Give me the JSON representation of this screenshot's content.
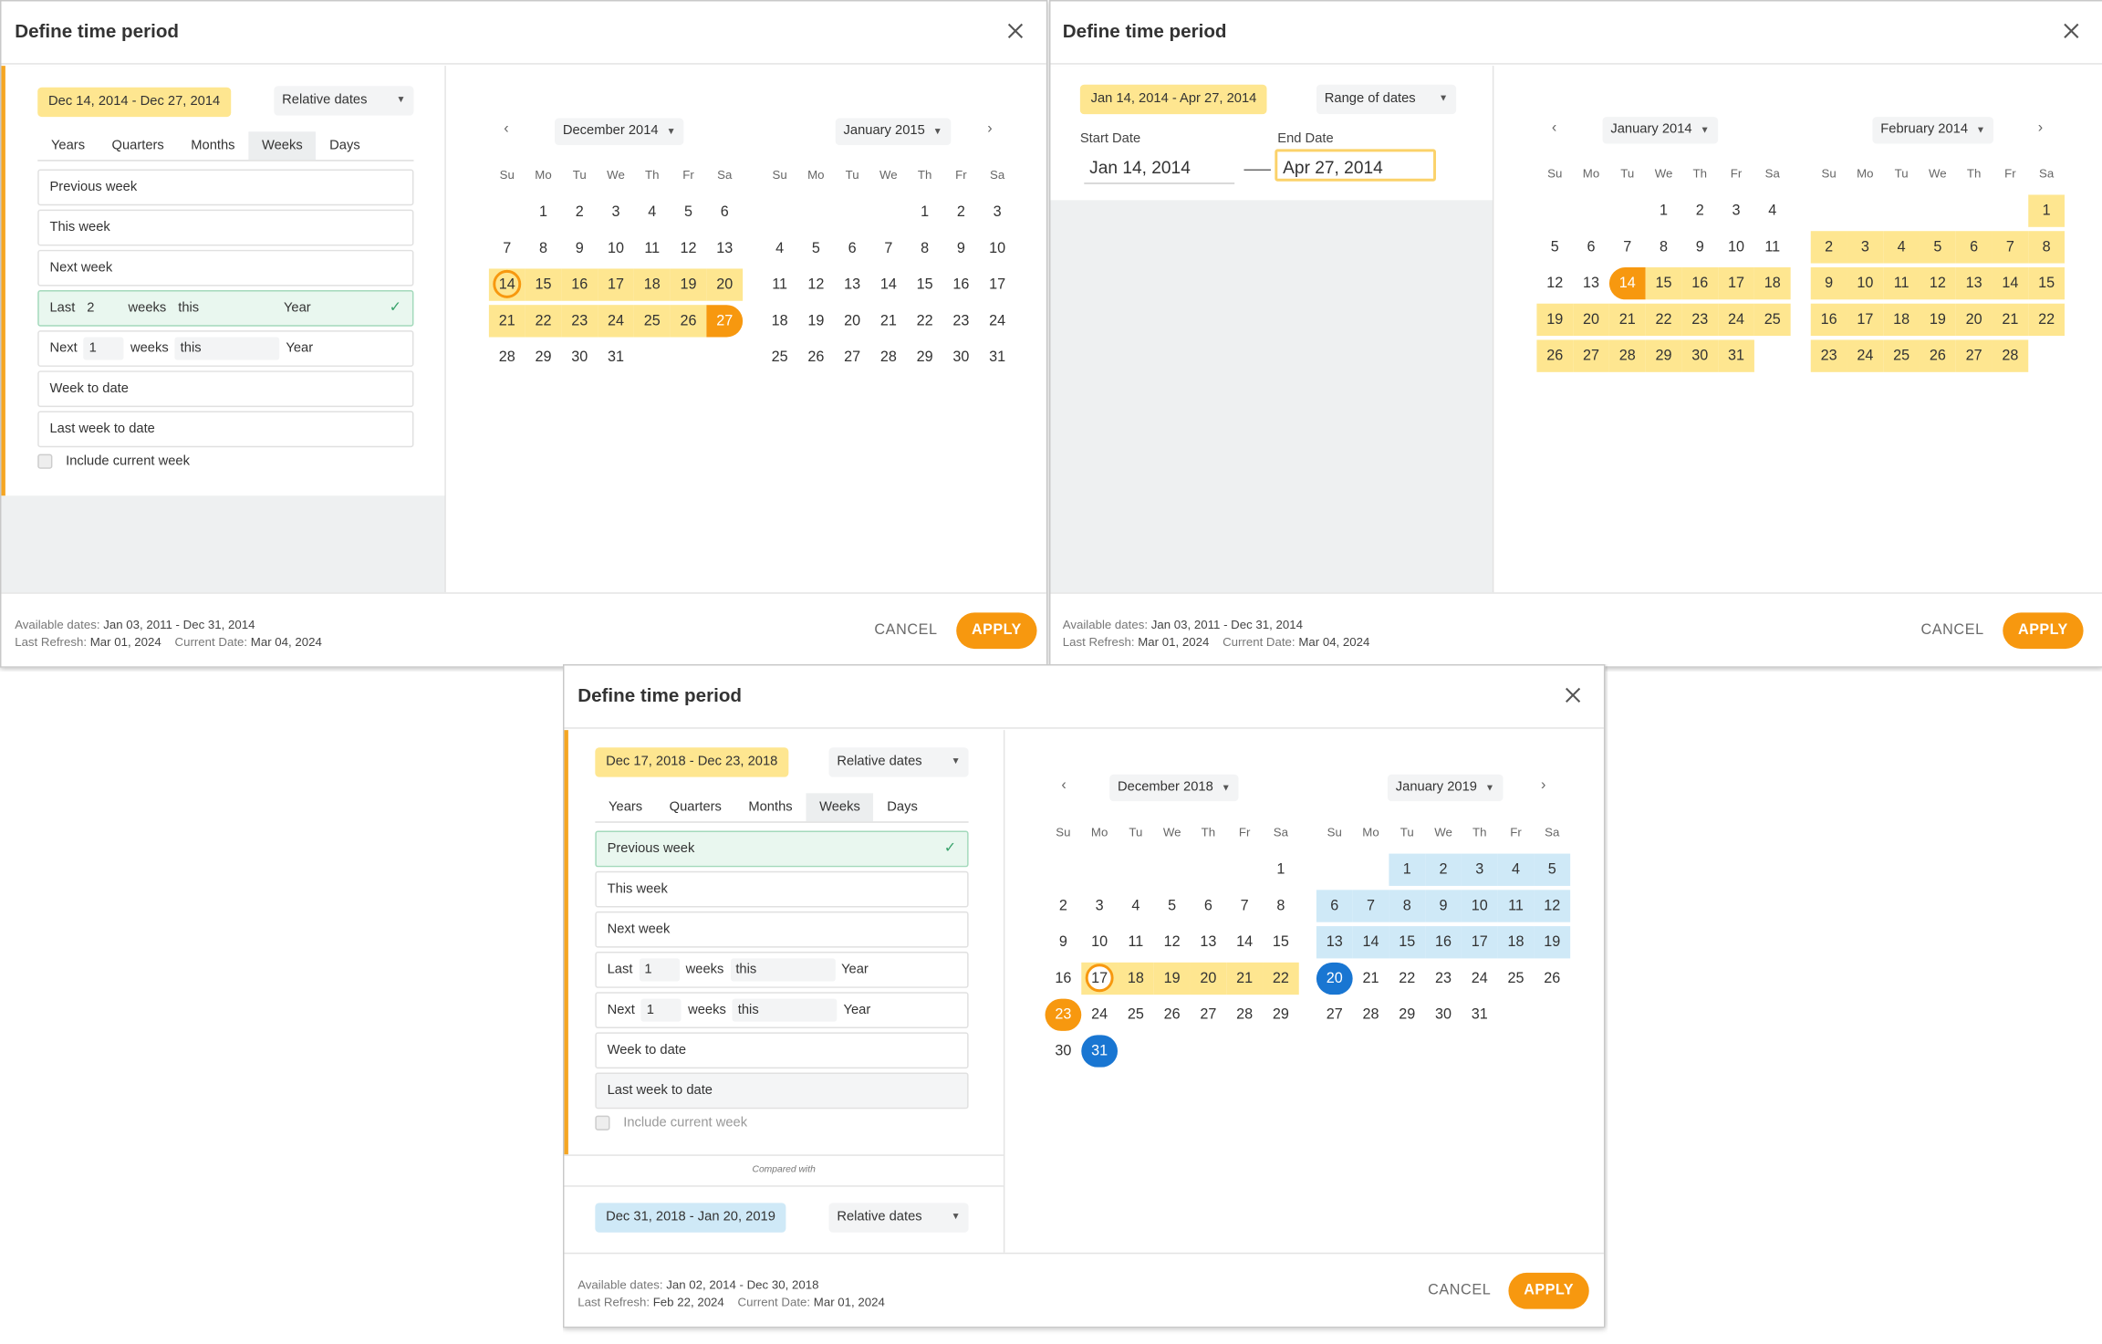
{
  "close_glyph": "×",
  "dialogs": [
    {
      "title": "Define time period",
      "range_label": "Dec 14, 2014 - Dec 27, 2014",
      "mode": "Relative dates",
      "tabs": [
        "Years",
        "Quarters",
        "Months",
        "Weeks",
        "Days"
      ],
      "active_tab": "Weeks",
      "options": [
        "Previous week",
        "This week",
        "Next week",
        "Week to date",
        "Last week to date"
      ],
      "last_row": {
        "prefix": "Last",
        "count": "2",
        "unit": "weeks",
        "this": "this",
        "period": "Year"
      },
      "next_row": {
        "prefix": "Next",
        "count": "1",
        "unit": "weeks",
        "this": "this",
        "period": "Year"
      },
      "checkbox": "Include current week",
      "months": [
        "December 2014",
        "January 2015"
      ],
      "weekdays": [
        "Su",
        "Mo",
        "Tu",
        "We",
        "Th",
        "Fr",
        "Sa"
      ],
      "footer": {
        "available": "Available dates:",
        "available_v": "Jan 03, 2011 - Dec 31, 2014",
        "refresh": "Last Refresh:",
        "refresh_v": "Mar 01, 2024",
        "current": "Current Date:",
        "current_v": "Mar 04, 2024"
      },
      "cancel": "CANCEL",
      "apply": "APPLY"
    },
    {
      "title": "Define time period",
      "range_label": "Jan 14, 2014 - Apr 27, 2014",
      "mode": "Range of dates",
      "start_label": "Start Date",
      "start_value": "Jan 14, 2014",
      "end_label": "End Date",
      "end_value": "Apr 27, 2014",
      "months": [
        "January 2014",
        "February 2014"
      ],
      "footer": {
        "available": "Available dates:",
        "available_v": "Jan 03, 2011 - Dec 31, 2014",
        "refresh": "Last Refresh:",
        "refresh_v": "Mar 01, 2024",
        "current": "Current Date:",
        "current_v": "Mar 04, 2024"
      },
      "cancel": "CANCEL",
      "apply": "APPLY"
    },
    {
      "title": "Define time period",
      "range_label": "Dec 17, 2018 - Dec 23, 2018",
      "mode": "Relative dates",
      "tabs": [
        "Years",
        "Quarters",
        "Months",
        "Weeks",
        "Days"
      ],
      "active_tab": "Weeks",
      "options": [
        "Previous week",
        "This week",
        "Next week",
        "Week to date",
        "Last week to date"
      ],
      "last_row": {
        "prefix": "Last",
        "count": "1",
        "unit": "weeks",
        "this": "this",
        "period": "Year"
      },
      "next_row": {
        "prefix": "Next",
        "count": "1",
        "unit": "weeks",
        "this": "this",
        "period": "Year"
      },
      "checkbox": "Include current week",
      "compared_with": "Compared with",
      "compare_range": "Dec 31, 2018 - Jan 20, 2019",
      "compare_mode": "Relative dates",
      "months": [
        "December 2018",
        "January 2019"
      ],
      "footer": {
        "available": "Available dates:",
        "available_v": "Jan 02, 2014 - Dec 30, 2018",
        "refresh": "Last Refresh:",
        "refresh_v": "Feb 22, 2024",
        "current": "Current Date:",
        "current_v": "Mar 01, 2024"
      },
      "cancel": "CANCEL",
      "apply": "APPLY"
    }
  ],
  "calendars": {
    "c1": {
      "start": 1,
      "days": 31,
      "hl": {
        "14": "ring",
        "15": "y",
        "16": "y",
        "17": "y",
        "18": "y",
        "19": "y",
        "20": "y",
        "21": "y",
        "22": "y",
        "23": "y",
        "24": "y",
        "25": "y",
        "26": "y",
        "27": "sel r"
      }
    },
    "c2": {
      "start": 4,
      "days": 31,
      "hl": {}
    },
    "c3": {
      "start": 3,
      "days": 31,
      "hl": {
        "14": "sel l",
        "15": "y",
        "16": "y",
        "17": "y",
        "18": "y",
        "19": "y",
        "20": "y",
        "21": "y",
        "22": "y",
        "23": "y",
        "24": "y",
        "25": "y",
        "26": "y",
        "27": "y",
        "28": "y",
        "29": "y",
        "30": "y",
        "31": "y"
      }
    },
    "c4": {
      "start": 6,
      "days": 28,
      "hl": {
        "1": "y",
        "2": "y",
        "3": "y",
        "4": "y",
        "5": "y",
        "6": "y",
        "7": "y",
        "8": "y",
        "9": "y",
        "10": "y",
        "11": "y",
        "12": "y",
        "13": "y",
        "14": "y",
        "15": "y",
        "16": "y",
        "17": "y",
        "18": "y",
        "19": "y",
        "20": "y",
        "21": "y",
        "22": "y",
        "23": "y",
        "24": "y",
        "25": "y",
        "26": "y",
        "27": "y",
        "28": "y"
      }
    },
    "c5": {
      "start": 6,
      "days": 31,
      "hl": {
        "17": "ring white",
        "18": "y",
        "19": "y",
        "20": "y",
        "21": "y",
        "22": "y",
        "23": "sel rr",
        "31": "bsel rr"
      }
    },
    "c6": {
      "start": 2,
      "days": 31,
      "hl": {
        "1": "b",
        "2": "b",
        "3": "b",
        "4": "b",
        "5": "b",
        "6": "b",
        "7": "b",
        "8": "b",
        "9": "b",
        "10": "b",
        "11": "b",
        "12": "b",
        "13": "b",
        "14": "b",
        "15": "b",
        "16": "b",
        "17": "b",
        "18": "b",
        "19": "b",
        "20": "bsel rr"
      }
    }
  }
}
